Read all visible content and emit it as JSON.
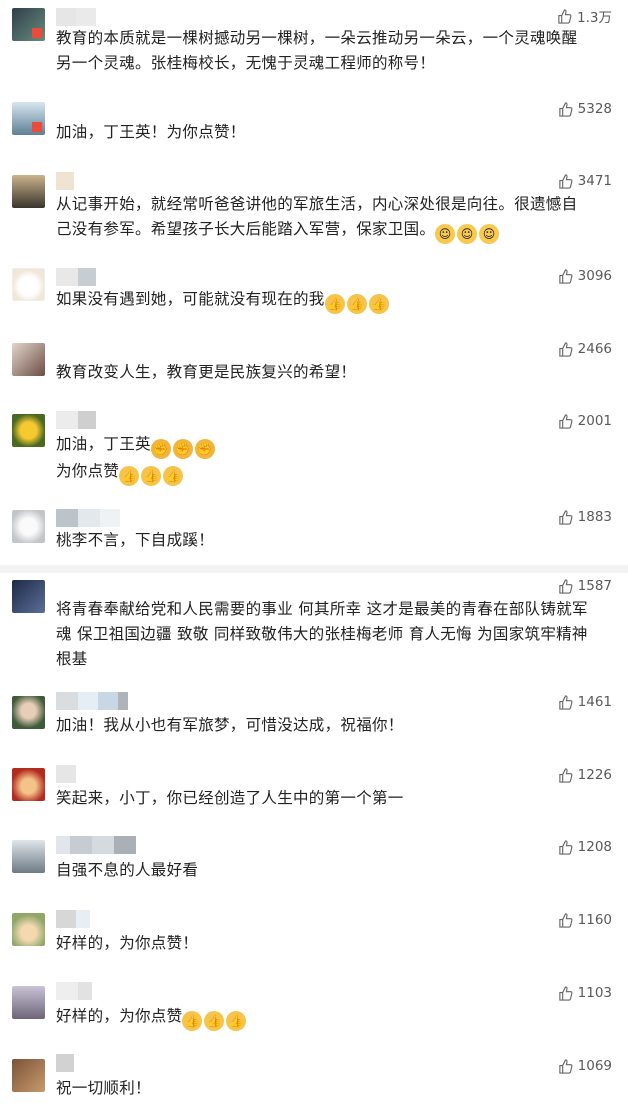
{
  "comments": [
    {
      "likes": "1.3万",
      "lines": [
        "教育的本质就是一棵树撼动另一棵树，一朵云推动另一朵云，一个灵魂唤醒",
        "另一个灵魂。张桂梅校长，无愧于灵魂工程师的称号！"
      ]
    },
    {
      "likes": "5328",
      "lines": [
        "加油，丁王英！为你点赞！"
      ]
    },
    {
      "likes": "3471",
      "lines": [
        "从记事开始，就经常听爸爸讲他的军旅生活，内心深处很是向往。很遗憾自",
        "己没有参军。希望孩子长大后能踏入军营，保家卫国。"
      ]
    },
    {
      "likes": "3096",
      "lines": [
        "如果没有遇到她，可能就没有现在的我"
      ]
    },
    {
      "likes": "2466",
      "lines": [
        "教育改变人生，教育更是民族复兴的希望！"
      ]
    },
    {
      "likes": "2001",
      "lines": [
        "加油，丁王英",
        "为你点赞"
      ]
    },
    {
      "likes": "1883",
      "lines": [
        "桃李不言，下自成蹊！"
      ]
    },
    {
      "likes": "1587",
      "lines": [
        "将青春奉献给党和人民需要的事业 何其所幸 这才是最美的青春在部队铸就军",
        "魂 保卫祖国边疆 致敬 同样致敬伟大的张桂梅老师 育人无悔 为国家筑牢精神",
        "根基"
      ]
    },
    {
      "likes": "1461",
      "lines": [
        "加油！我从小也有军旅梦，可惜没达成，祝福你！"
      ]
    },
    {
      "likes": "1226",
      "lines": [
        "笑起来，小丁，你已经创造了人生中的第一个第一"
      ]
    },
    {
      "likes": "1208",
      "lines": [
        "自强不息的人最好看"
      ]
    },
    {
      "likes": "1160",
      "lines": [
        "好样的，为你点赞！"
      ]
    },
    {
      "likes": "1103",
      "lines": [
        "好样的，为你点赞"
      ]
    },
    {
      "likes": "1069",
      "lines": [
        "祝一切顺利！"
      ]
    }
  ],
  "icons": {
    "like": "thumbs-up-outline-icon",
    "thumb_emoji": "thumbs-up-emoji",
    "fist_emoji": "fist-emoji",
    "bless_emoji": "salute-emoji"
  },
  "colors": {
    "likes_text": "#5a5a5a",
    "comment_text": "#222222",
    "badge": "#e94b3c"
  }
}
